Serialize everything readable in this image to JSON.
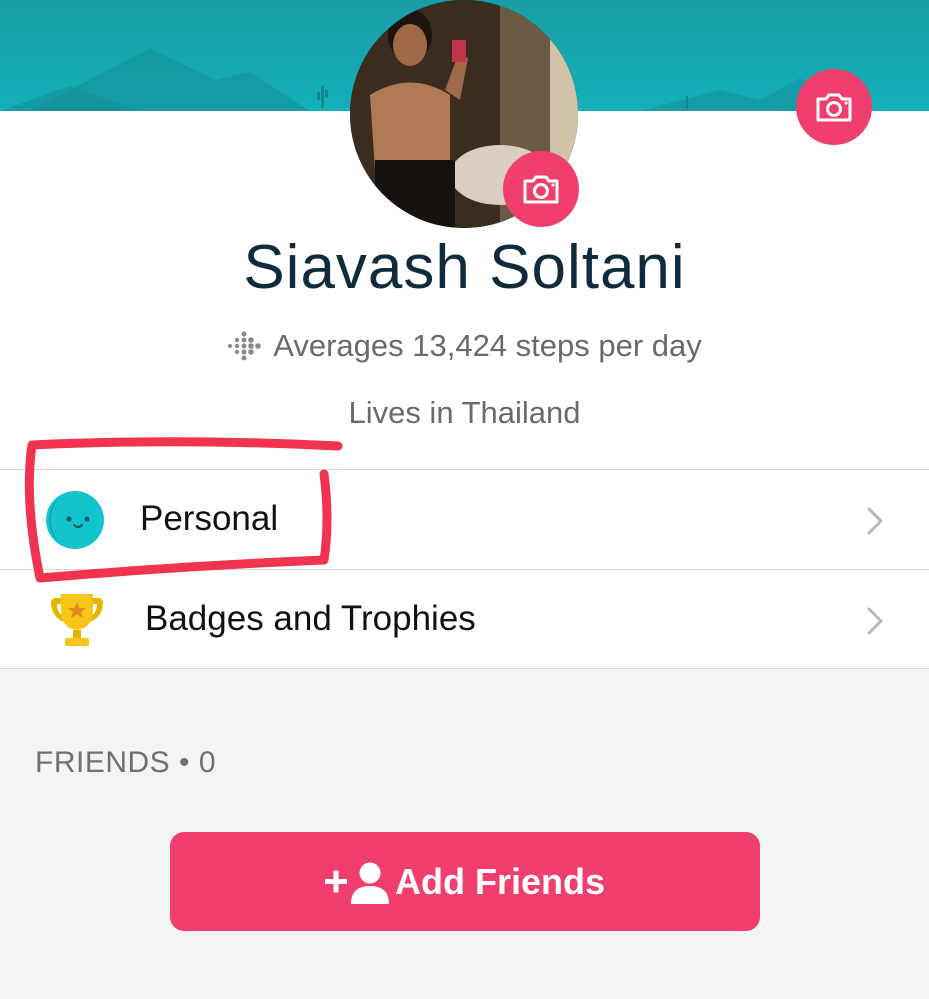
{
  "profile": {
    "name": "Siavash Soltani",
    "steps_text": "Averages 13,424 steps per day",
    "location_text": "Lives in Thailand"
  },
  "menu": {
    "personal_label": "Personal",
    "badges_label": "Badges and Trophies"
  },
  "friends": {
    "header": "FRIENDS • 0",
    "add_button_label": "Add Friends"
  },
  "colors": {
    "accent": "#f03f6e",
    "cover": "#13b0b9",
    "personal_icon": "#14c4cc",
    "trophy": "#f5c518",
    "annotation": "#f0334f"
  },
  "icons": [
    "camera-icon",
    "fitbit-dots-icon",
    "smiley-face-icon",
    "trophy-icon",
    "chevron-right-icon",
    "add-person-icon"
  ]
}
